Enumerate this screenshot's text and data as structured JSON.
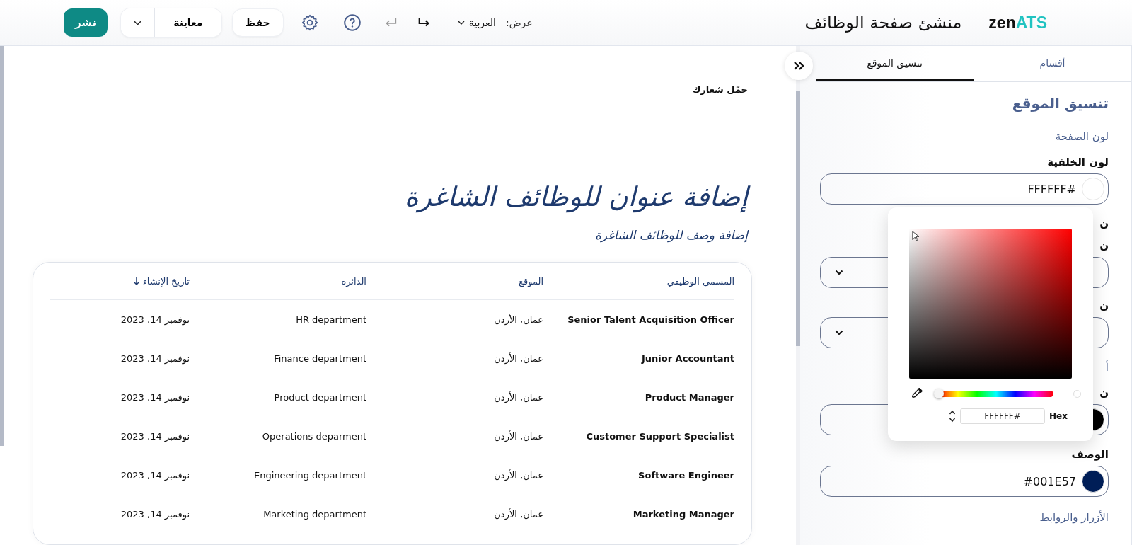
{
  "header": {
    "logo": {
      "prefix": "zen",
      "suffix": "ATS"
    },
    "title": "منشئ صفحة الوظائف",
    "view_label": "عرض:",
    "language": "العربية",
    "undo_disabled": true,
    "redo_disabled": false,
    "save": "حفظ",
    "preview": "معاينة",
    "publish": "نشر"
  },
  "canvas": {
    "logo_upload": "حمّل شعارك",
    "heading": "إضافة عنوان للوظائف الشاغرة",
    "description": "إضافة وصف للوظائف الشاغرة",
    "table": {
      "columns": [
        {
          "label": "المسمى الوظيفي",
          "sorted": false
        },
        {
          "label": "الموقع",
          "sorted": false
        },
        {
          "label": "الدائرة",
          "sorted": false
        },
        {
          "label": "تاريخ الإنشاء",
          "sorted": true
        }
      ],
      "rows": [
        [
          "Senior Talent Acquisition Officer",
          "عمان, الأردن",
          "HR department",
          "نوفمبر 14, 2023"
        ],
        [
          "Junior Accountant",
          "عمان, الأردن",
          "Finance department",
          "نوفمبر 14, 2023"
        ],
        [
          "Product Manager",
          "عمان, الأردن",
          "Product department",
          "نوفمبر 14, 2023"
        ],
        [
          "Customer Support Specialist",
          "عمان, الأردن",
          "Operations deparment",
          "نوفمبر 14, 2023"
        ],
        [
          "Software Engineer",
          "عمان, الأردن",
          "Engineering department",
          "نوفمبر 14, 2023"
        ],
        [
          "Marketing Manager",
          "عمان, الأردن",
          "Marketing department",
          "نوفمبر 14, 2023"
        ]
      ]
    }
  },
  "panel": {
    "tabs": [
      {
        "label": "أقسام",
        "selected": false
      },
      {
        "label": "تنسيق الموقع",
        "selected": true
      }
    ],
    "items": [
      {
        "kind": "heading",
        "text": "تنسيق الموقع"
      },
      {
        "kind": "subheading",
        "text": "لون الصفحة"
      },
      {
        "kind": "label",
        "text": "لون الخلفية"
      },
      {
        "kind": "color",
        "value": "FFFFFF#",
        "color": "#ffffff"
      },
      {
        "kind": "label",
        "text": "ن"
      },
      {
        "kind": "label",
        "text": "ن"
      },
      {
        "kind": "select"
      },
      {
        "kind": "label",
        "text": "ن"
      },
      {
        "kind": "select"
      },
      {
        "kind": "subheading",
        "text": "أ"
      },
      {
        "kind": "label",
        "text": "ن"
      },
      {
        "kind": "color",
        "color": "#000000"
      },
      {
        "kind": "label",
        "text": "الوصف"
      },
      {
        "kind": "color",
        "value": "#001E57",
        "color": "#001e57"
      },
      {
        "kind": "subheading",
        "text": "الأزرار والروابط"
      }
    ]
  },
  "picker": {
    "hex": "FFFFFF#",
    "format": "Hex",
    "hue": {
      "level": 0
    }
  }
}
